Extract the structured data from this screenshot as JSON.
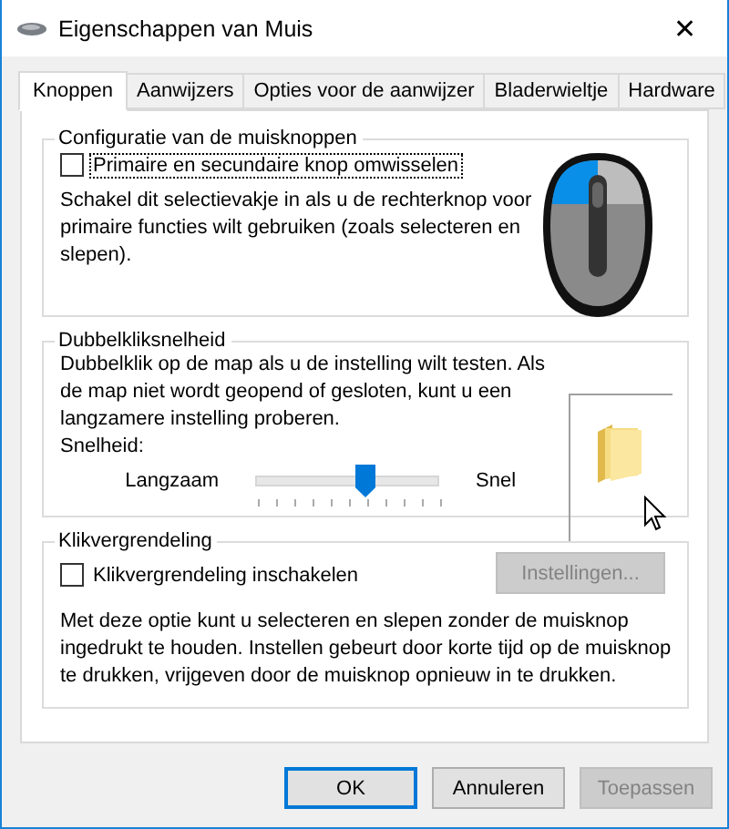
{
  "window": {
    "title": "Eigenschappen van Muis",
    "close": "✕"
  },
  "tabs": [
    {
      "label": "Knoppen",
      "selected": true
    },
    {
      "label": "Aanwijzers",
      "selected": false
    },
    {
      "label": "Opties voor de aanwijzer",
      "selected": false
    },
    {
      "label": "Bladerwieltje",
      "selected": false
    },
    {
      "label": "Hardware",
      "selected": false
    }
  ],
  "button_config": {
    "title": "Configuratie van de muisknoppen",
    "checkbox": {
      "label": "Primaire en secundaire knop omwisselen",
      "checked": false,
      "focused": true
    },
    "description": "Schakel dit selectievakje in als u de rechterknop voor primaire functies wilt gebruiken (zoals selecteren en slepen)."
  },
  "double_click": {
    "title": "Dubbelkliksnelheid",
    "description": "Dubbelklik op de map als u de instelling wilt testen. Als de map niet wordt geopend of gesloten, kunt u een langzamere instelling proberen.",
    "speed_label": "Snelheid:",
    "slider": {
      "min_label": "Langzaam",
      "max_label": "Snel",
      "level": 0.6
    }
  },
  "click_lock": {
    "title": "Klikvergrendeling",
    "checkbox": {
      "label": "Klikvergrendeling inschakelen",
      "checked": false
    },
    "settings_button": {
      "label": "Instellingen...",
      "disabled": true
    },
    "description": "Met deze optie kunt u selecteren en slepen zonder de muisknop ingedrukt te houden. Instellen gebeurt door korte tijd op de muisknop te drukken, vrijgeven door de muisknop opnieuw in te drukken."
  },
  "buttons": [
    {
      "label": "OK",
      "default": true,
      "disabled": false
    },
    {
      "label": "Annuleren",
      "default": false,
      "disabled": false
    },
    {
      "label": "Toepassen",
      "default": false,
      "disabled": true
    }
  ]
}
